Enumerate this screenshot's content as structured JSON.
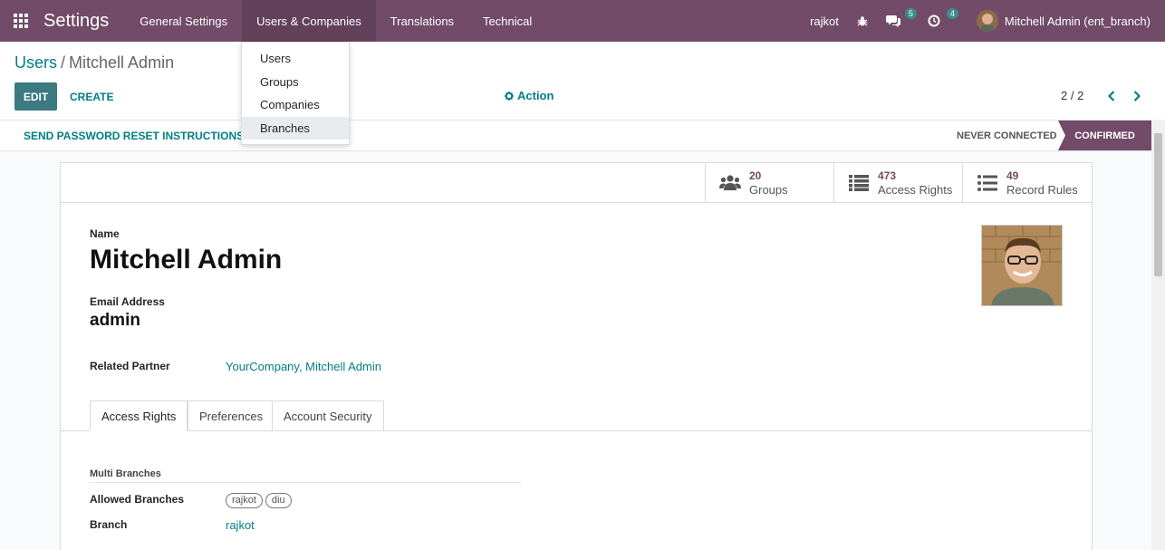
{
  "navbar": {
    "app_title": "Settings",
    "menu": [
      "General Settings",
      "Users & Companies",
      "Translations",
      "Technical"
    ],
    "branch": "rajkot",
    "messages_count": "5",
    "activities_count": "4",
    "user": "Mitchell Admin (ent_branch)",
    "bg_color": "#714b67"
  },
  "dropdown": {
    "items": [
      "Users",
      "Groups",
      "Companies",
      "Branches"
    ],
    "highlighted": "Branches"
  },
  "breadcrumb": {
    "parent": "Users",
    "separator": "/",
    "current": "Mitchell Admin"
  },
  "toolbar": {
    "edit_label": "EDIT",
    "create_label": "CREATE",
    "action_label": "Action",
    "pager": "2 / 2"
  },
  "statusbar": {
    "reset_label": "SEND PASSWORD RESET INSTRUCTIONS",
    "stage_never": "NEVER CONNECTED",
    "stage_confirmed": "CONFIRMED"
  },
  "stat_buttons": [
    {
      "value": "20",
      "label": "Groups",
      "icon": "users-icon"
    },
    {
      "value": "473",
      "label": "Access Rights",
      "icon": "list-icon"
    },
    {
      "value": "49",
      "label": "Record Rules",
      "icon": "list-icon"
    }
  ],
  "form": {
    "name_label": "Name",
    "name_value": "Mitchell Admin",
    "email_label": "Email Address",
    "email_value": "admin",
    "partner_label": "Related Partner",
    "partner_value": "YourCompany, Mitchell Admin"
  },
  "tabs": [
    "Access Rights",
    "Preferences",
    "Account Security"
  ],
  "access_rights": {
    "section_title": "Multi Branches",
    "allowed_label": "Allowed Branches",
    "allowed_values": [
      "rajkot",
      "diu"
    ],
    "branch_label": "Branch",
    "branch_value": "rajkot"
  },
  "colors": {
    "brand": "#714b67",
    "link": "#017e84",
    "edit_button": "#3a7a80"
  }
}
